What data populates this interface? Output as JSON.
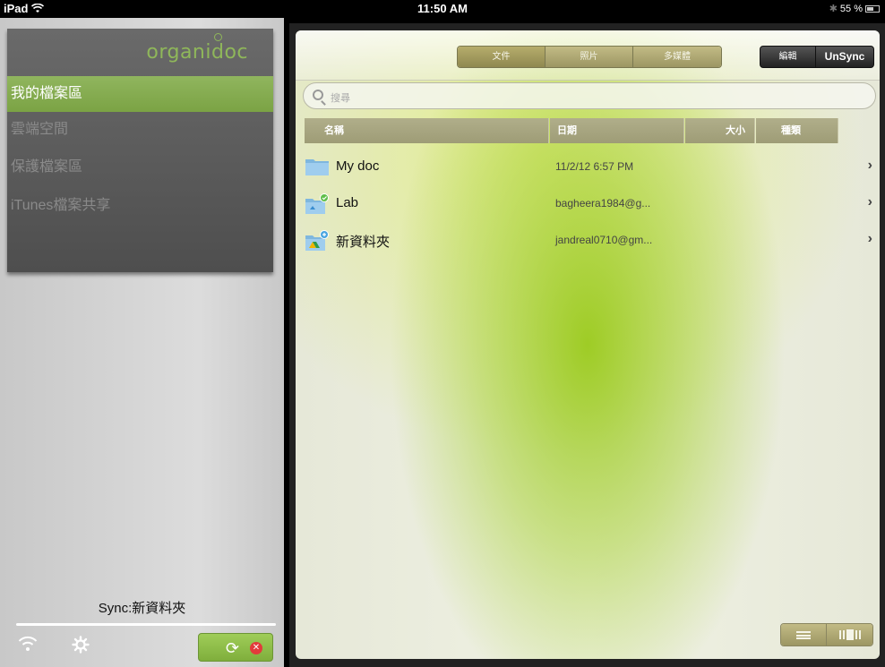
{
  "status_bar": {
    "device": "iPad",
    "time": "11:50 AM",
    "battery": "55 %"
  },
  "sidebar": {
    "brand": "organidoc",
    "items": [
      {
        "label": "我的檔案區",
        "active": true
      },
      {
        "label": "雲端空間",
        "active": false
      },
      {
        "label": "保護檔案區",
        "active": false
      },
      {
        "label": "iTunes檔案共享",
        "active": false
      }
    ],
    "sync_label": "Sync:新資料夾"
  },
  "toolbar": {
    "tabs": [
      "文件",
      "照片",
      "多媒體"
    ],
    "active_tab": 0,
    "edit_label": "編輯",
    "unsync_label": "UnSync"
  },
  "search": {
    "placeholder": "搜尋"
  },
  "table": {
    "columns": {
      "name": "名稱",
      "date": "日期",
      "size": "大小",
      "kind": "種類"
    },
    "rows": [
      {
        "name": "My doc",
        "date": "11/2/12 6:57 PM",
        "icon": "folder-icon"
      },
      {
        "name": "Lab",
        "date": "bagheera1984@g...",
        "icon": "shared-folder-icon"
      },
      {
        "name": "新資料夾",
        "date": "jandreal0710@gm...",
        "icon": "drive-folder-icon"
      }
    ]
  },
  "colors": {
    "accent_green": "#8fb75a",
    "tab_khaki": "#aaa36c"
  }
}
